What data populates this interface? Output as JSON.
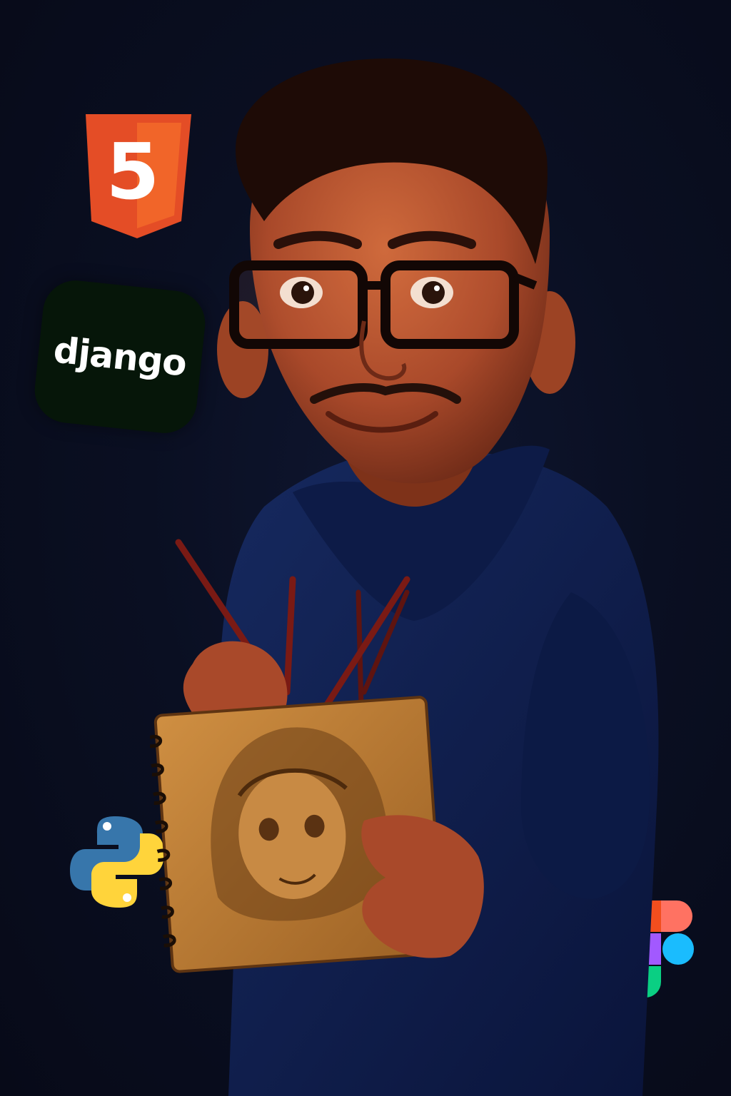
{
  "logos": {
    "html5": {
      "label": "5",
      "color": "#e44d26",
      "shade": "#f16529"
    },
    "django": {
      "label": "django",
      "bg": "#061609"
    },
    "python": {
      "blue": "#3776ab",
      "yellow": "#ffd43b"
    },
    "figma": {
      "colors": [
        "#f24e1e",
        "#ff7262",
        "#a259ff",
        "#1abcfe",
        "#0acf83"
      ]
    }
  },
  "palette": {
    "background": "#090d1f",
    "hoodie": "#0f1f4d",
    "skin": "#b5532e",
    "sketchbook": "#c8873a"
  }
}
